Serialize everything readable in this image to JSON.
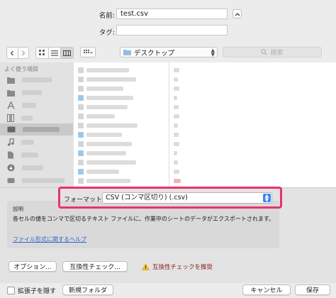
{
  "save": {
    "name_label": "名前:",
    "name_value": "test.csv",
    "tag_label": "タグ:",
    "tag_value": ""
  },
  "toolbar": {
    "location": "デスクトップ",
    "search_placeholder": "検索"
  },
  "sidebar": {
    "header": "よく使う項目"
  },
  "format": {
    "label": "フォーマット:",
    "selected": "CSV (コンマ区切り) (.csv)"
  },
  "description": {
    "heading": "説明",
    "text": "各セルの値をコンマで区切るテキスト ファイルに、作業中のシートのデータがエクスポートされます。",
    "help_link": "ファイル形式に関するヘルプ"
  },
  "options": {
    "options_button": "オプション...",
    "compat_button": "互換性チェック...",
    "warning_text": "互換性チェックを推奨"
  },
  "footer": {
    "hide_extension": "拡張子を隠す",
    "new_folder": "新規フォルダ",
    "cancel": "キャンセル",
    "save": "保存"
  },
  "colors": {
    "highlight_border": "#e8336d",
    "accent_blue": "#3b83f5",
    "warning_yellow": "#f2c11d",
    "warning_text": "#8a1c1c"
  }
}
